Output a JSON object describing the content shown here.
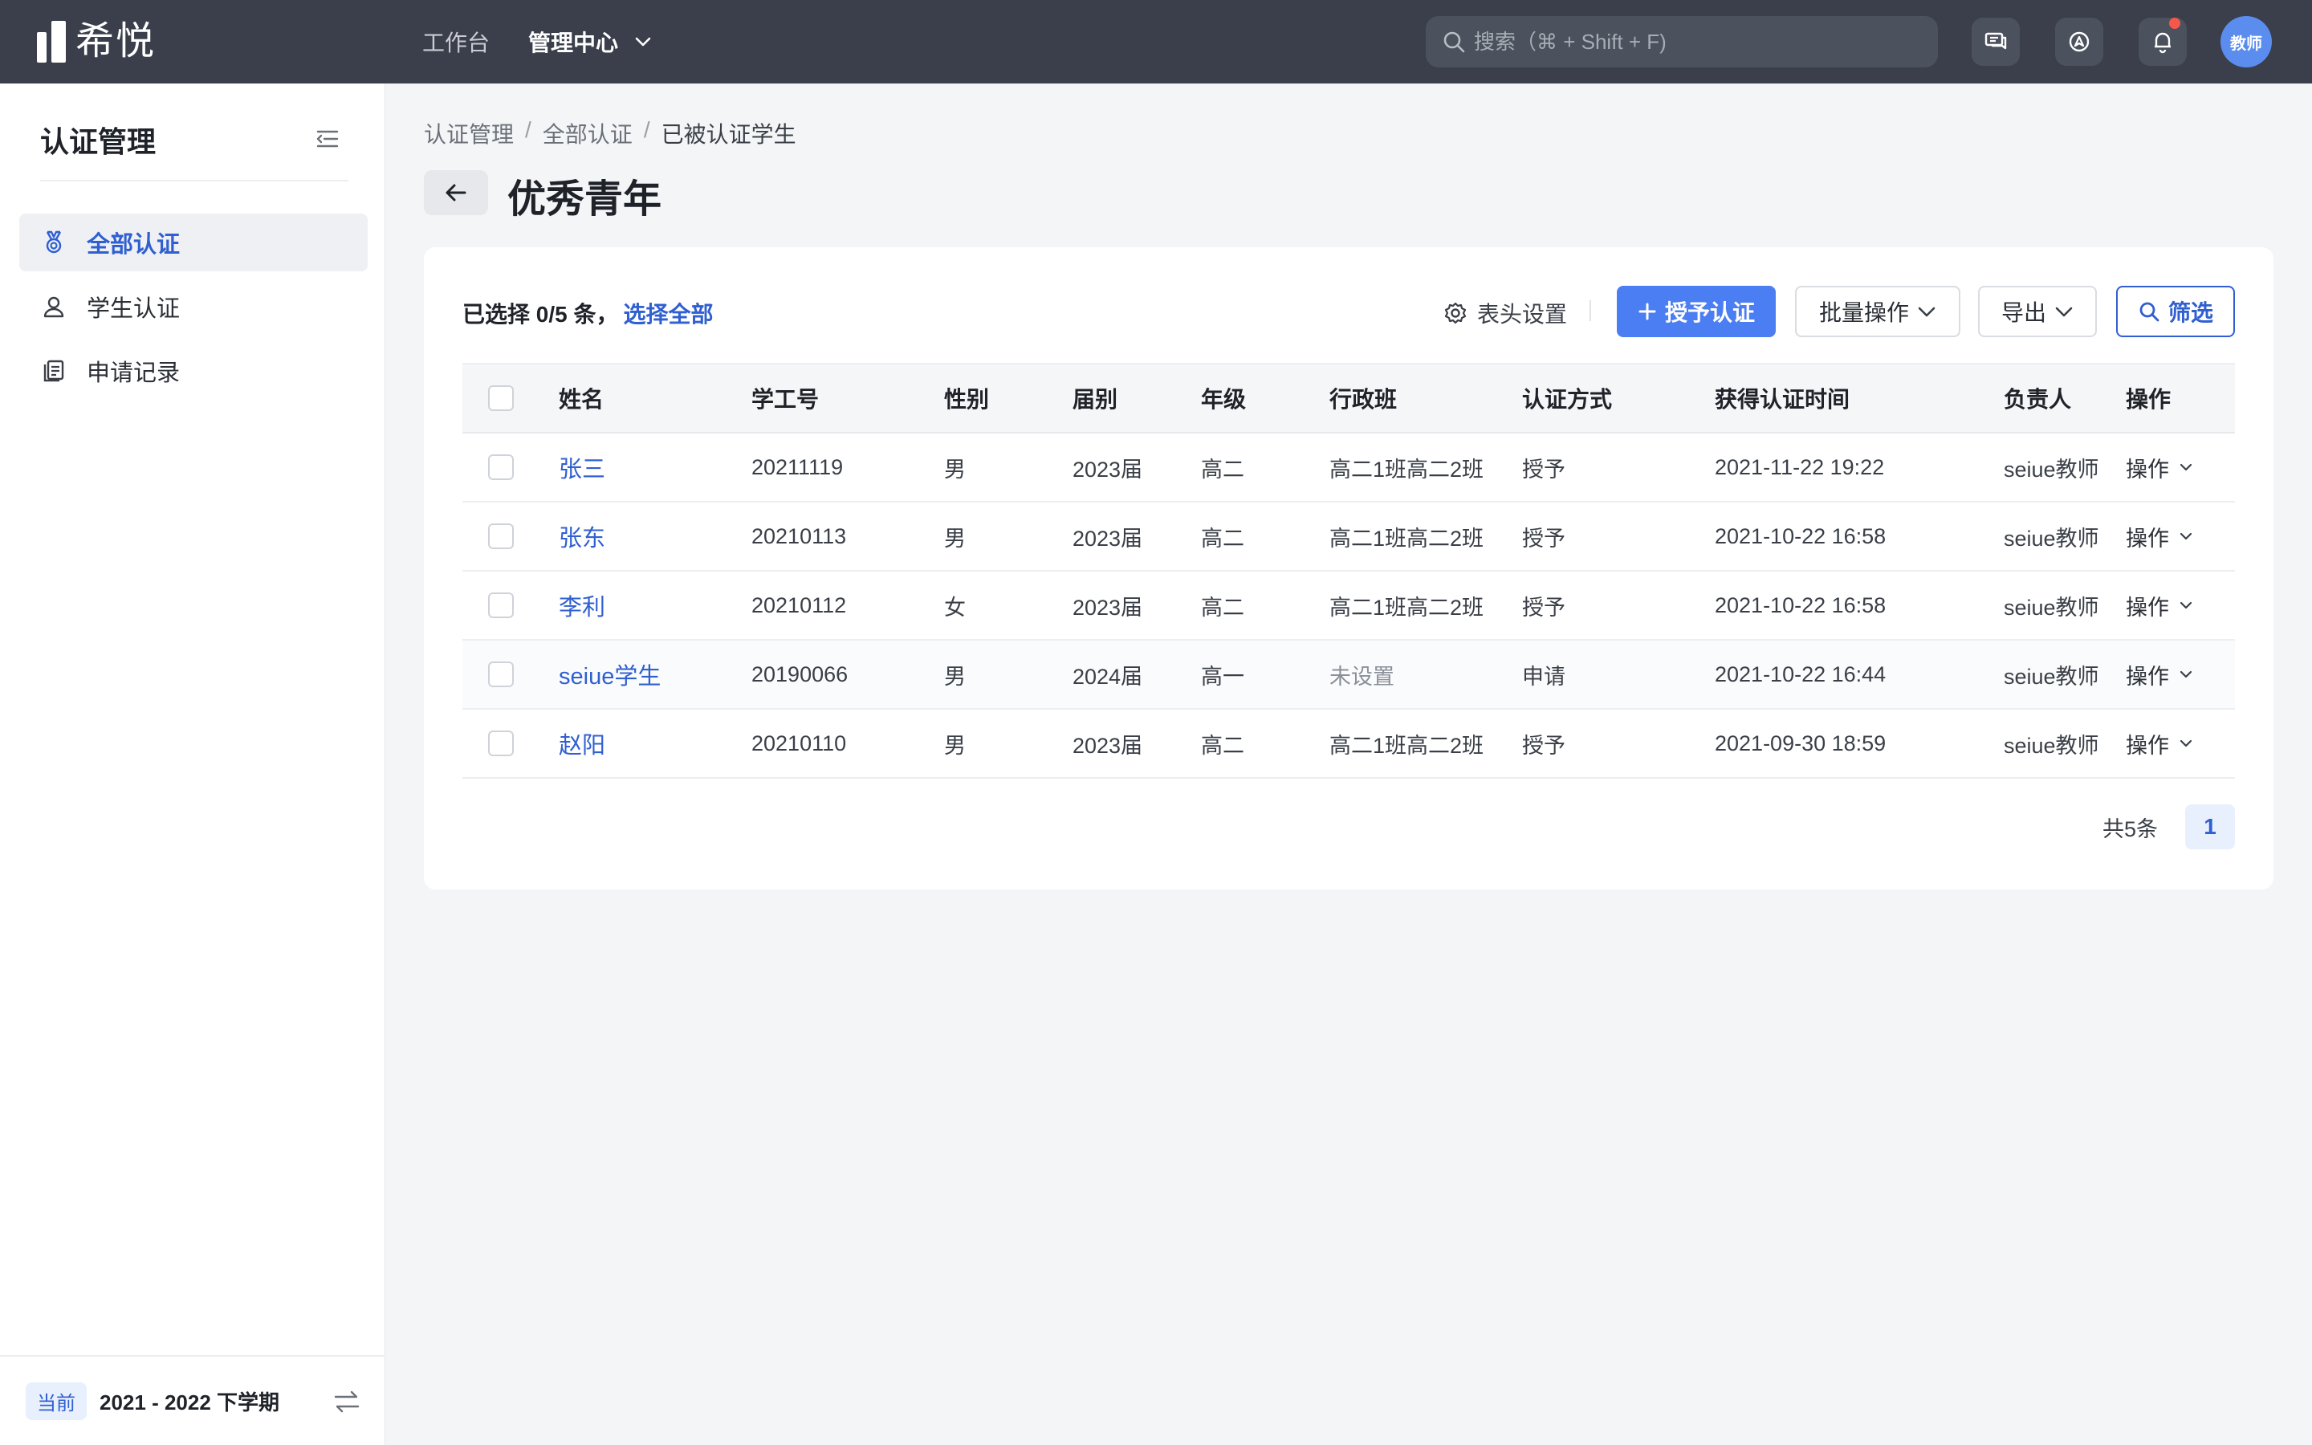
{
  "app": {
    "logo_text": "希悦"
  },
  "topnav": {
    "workbench": "工作台",
    "admin_center": "管理中心"
  },
  "search": {
    "placeholder": "搜索（⌘ + Shift + F)"
  },
  "user": {
    "avatar_label": "教师"
  },
  "sidebar": {
    "title": "认证管理",
    "items": [
      {
        "label": "全部认证",
        "icon": "medal-icon",
        "active": true
      },
      {
        "label": "学生认证",
        "icon": "user-icon",
        "active": false
      },
      {
        "label": "申请记录",
        "icon": "document-icon",
        "active": false
      }
    ],
    "footer": {
      "badge": "当前",
      "term": "2021 - 2022 下学期"
    }
  },
  "breadcrumb": {
    "level1": "认证管理",
    "level2": "全部认证",
    "current": "已被认证学生",
    "separator": "/"
  },
  "page": {
    "title": "优秀青年"
  },
  "toolbar": {
    "selected_text": "已选择 0/5 条，",
    "select_all": "选择全部",
    "column_settings": "表头设置",
    "grant": "授予认证",
    "batch": "批量操作",
    "export": "导出",
    "filter": "筛选"
  },
  "table": {
    "headers": {
      "name": "姓名",
      "id": "学工号",
      "gender": "性别",
      "cohort": "届别",
      "grade": "年级",
      "class": "行政班",
      "method": "认证方式",
      "time": "获得认证时间",
      "owner": "负责人",
      "action": "操作"
    },
    "rows": [
      {
        "name": "张三",
        "id": "20211119",
        "gender": "男",
        "cohort": "2023届",
        "grade": "高二",
        "class": "高二1班高二2班",
        "method": "授予",
        "time": "2021-11-22 19:22",
        "owner": "seiue教师",
        "action": "操作"
      },
      {
        "name": "张东",
        "id": "20210113",
        "gender": "男",
        "cohort": "2023届",
        "grade": "高二",
        "class": "高二1班高二2班",
        "method": "授予",
        "time": "2021-10-22 16:58",
        "owner": "seiue教师",
        "action": "操作"
      },
      {
        "name": "李利",
        "id": "20210112",
        "gender": "女",
        "cohort": "2023届",
        "grade": "高二",
        "class": "高二1班高二2班",
        "method": "授予",
        "time": "2021-10-22 16:58",
        "owner": "seiue教师",
        "action": "操作"
      },
      {
        "name": "seiue学生",
        "id": "20190066",
        "gender": "男",
        "cohort": "2024届",
        "grade": "高一",
        "class": "未设置",
        "method": "申请",
        "time": "2021-10-22 16:44",
        "owner": "seiue教师",
        "action": "操作"
      },
      {
        "name": "赵阳",
        "id": "20210110",
        "gender": "男",
        "cohort": "2023届",
        "grade": "高二",
        "class": "高二1班高二2班",
        "method": "授予",
        "time": "2021-09-30 18:59",
        "owner": "seiue教师",
        "action": "操作"
      }
    ]
  },
  "pagination": {
    "total": "共5条",
    "current": "1"
  },
  "colors": {
    "topbar": "#3a3f4b",
    "accent": "#4c7ef3",
    "link": "#2f5fd0",
    "notification_dot": "#f5574b"
  }
}
